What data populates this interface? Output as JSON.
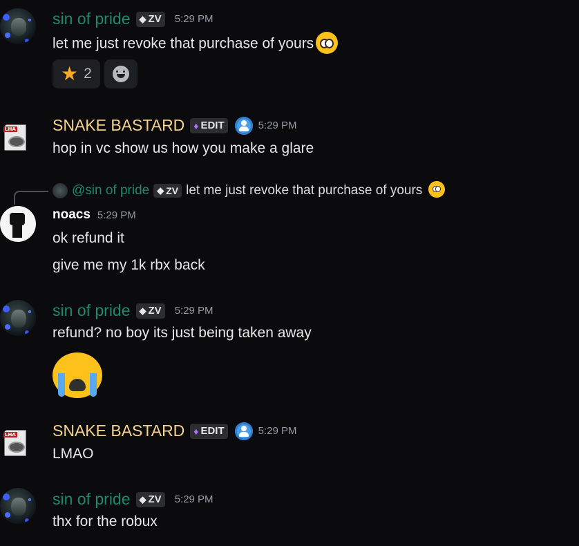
{
  "messages": [
    {
      "username": "sin of pride",
      "tag": "ZV",
      "time": "5:29 PM",
      "lines": [
        "let me just revoke that purchase of yours"
      ],
      "reactions": [
        {
          "icon": "star-icon",
          "count": "2"
        },
        {
          "icon": "add-reaction-icon"
        }
      ]
    },
    {
      "username": "SNAKE BASTARD",
      "tag": "EDIT",
      "time": "5:29 PM",
      "lines": [
        "hop in vc show us how you make a glare"
      ]
    },
    {
      "reply": {
        "username": "@sin of pride",
        "tag": "ZV",
        "text": "let me just revoke that purchase of yours"
      },
      "username": "noacs",
      "time": "5:29 PM",
      "lines": [
        "ok refund it",
        "give me my 1k rbx back"
      ]
    },
    {
      "username": "sin of pride",
      "tag": "ZV",
      "time": "5:29 PM",
      "lines": [
        "refund? no boy its just being taken away"
      ],
      "emoji": "loudly-crying-face"
    },
    {
      "username": "SNAKE BASTARD",
      "tag": "EDIT",
      "time": "5:29 PM",
      "lines": [
        "LMAO"
      ]
    },
    {
      "username": "sin of pride",
      "tag": "ZV",
      "time": "5:29 PM",
      "lines": [
        "thx for the robux"
      ]
    }
  ],
  "colors": {
    "background": "#0b0b0d",
    "sin_of_pride": "#1d8a6b",
    "snake_bastard": "#f5d18c",
    "noacs": "#ffffff",
    "timestamp": "#949ba4"
  }
}
